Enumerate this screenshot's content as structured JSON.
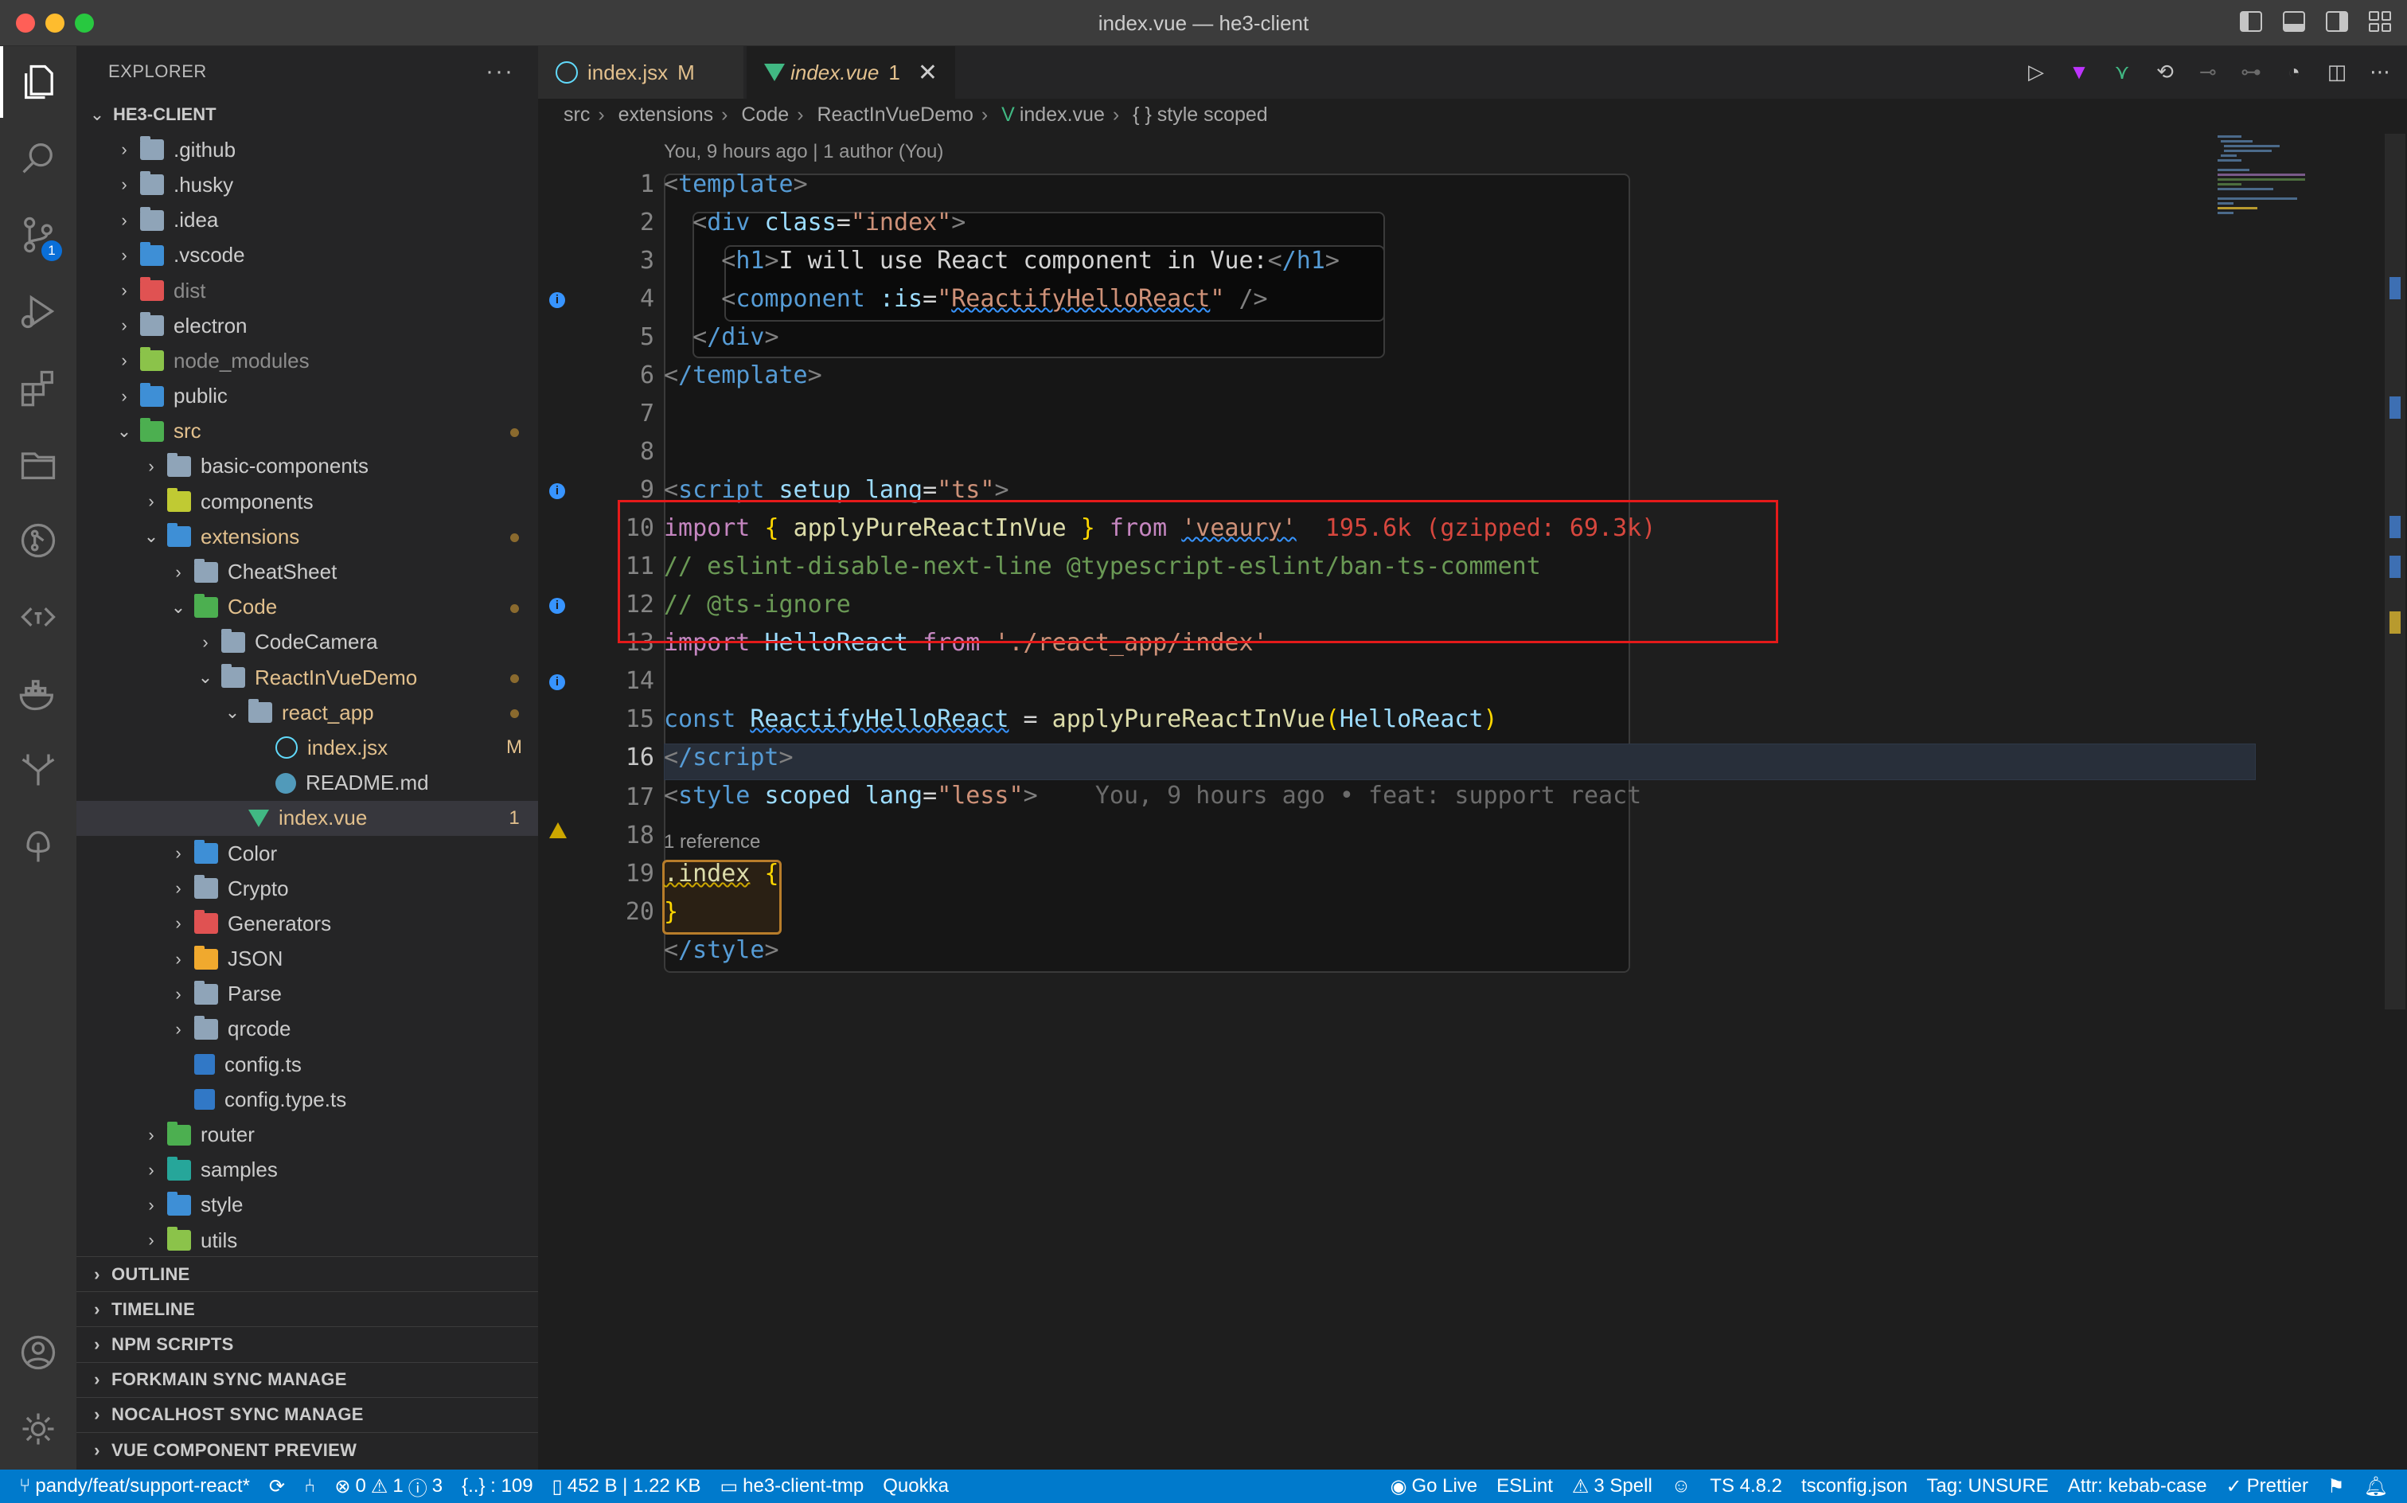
{
  "window": {
    "title": "index.vue — he3-client"
  },
  "activity": {
    "items": [
      "explorer-icon",
      "search-icon",
      "source-control-icon",
      "run-debug-icon",
      "extensions-icon",
      "folders-icon",
      "git-graph-icon",
      "tag-icon",
      "docker-icon",
      "antler-icon",
      "tree-icon"
    ],
    "source_control_badge": "1",
    "bottom": [
      "account-icon",
      "settings-gear-icon"
    ]
  },
  "explorer": {
    "header": "EXPLORER",
    "more": "···",
    "root": "HE3-CLIENT",
    "tree": [
      {
        "label": ".github",
        "indent": 1,
        "type": "folder",
        "chevron": "›",
        "color": "normal",
        "icon_color": "#8fa4b8",
        "status": ""
      },
      {
        "label": ".husky",
        "indent": 1,
        "type": "folder",
        "chevron": "›",
        "color": "normal",
        "icon_color": "#8fa4b8",
        "status": ""
      },
      {
        "label": ".idea",
        "indent": 1,
        "type": "folder",
        "chevron": "›",
        "color": "normal",
        "icon_color": "#8fa4b8",
        "status": ""
      },
      {
        "label": ".vscode",
        "indent": 1,
        "type": "folder",
        "chevron": "›",
        "color": "normal",
        "icon_color": "#3e8fd6",
        "status": ""
      },
      {
        "label": "dist",
        "indent": 1,
        "type": "folder",
        "chevron": "›",
        "color": "ignored",
        "icon_color": "#e05252",
        "status": ""
      },
      {
        "label": "electron",
        "indent": 1,
        "type": "folder",
        "chevron": "›",
        "color": "normal",
        "icon_color": "#8fa4b8",
        "status": ""
      },
      {
        "label": "node_modules",
        "indent": 1,
        "type": "folder",
        "chevron": "›",
        "color": "ignored",
        "icon_color": "#8bc34a",
        "status": ""
      },
      {
        "label": "public",
        "indent": 1,
        "type": "folder",
        "chevron": "›",
        "color": "normal",
        "icon_color": "#3e8fd6",
        "status": ""
      },
      {
        "label": "src",
        "indent": 1,
        "type": "folder",
        "chevron": "⌄",
        "color": "mod",
        "icon_color": "#4caf50",
        "status": "dot"
      },
      {
        "label": "basic-components",
        "indent": 2,
        "type": "folder",
        "chevron": "›",
        "color": "normal",
        "icon_color": "#8fa4b8",
        "status": ""
      },
      {
        "label": "components",
        "indent": 2,
        "type": "folder",
        "chevron": "›",
        "color": "normal",
        "icon_color": "#c0ca33",
        "status": ""
      },
      {
        "label": "extensions",
        "indent": 2,
        "type": "folder",
        "chevron": "⌄",
        "color": "mod",
        "icon_color": "#3e8fd6",
        "status": "dot"
      },
      {
        "label": "CheatSheet",
        "indent": 3,
        "type": "folder",
        "chevron": "›",
        "color": "normal",
        "icon_color": "#8fa4b8",
        "status": ""
      },
      {
        "label": "Code",
        "indent": 3,
        "type": "folder",
        "chevron": "⌄",
        "color": "mod",
        "icon_color": "#4caf50",
        "status": "dot"
      },
      {
        "label": "CodeCamera",
        "indent": 4,
        "type": "folder",
        "chevron": "›",
        "color": "normal",
        "icon_color": "#8fa4b8",
        "status": ""
      },
      {
        "label": "ReactInVueDemo",
        "indent": 4,
        "type": "folder",
        "chevron": "⌄",
        "color": "mod",
        "icon_color": "#8fa4b8",
        "status": "dot"
      },
      {
        "label": "react_app",
        "indent": 5,
        "type": "folder",
        "chevron": "⌄",
        "color": "mod",
        "icon_color": "#8fa4b8",
        "status": "dot"
      },
      {
        "label": "index.jsx",
        "indent": 6,
        "type": "jsx",
        "chevron": "",
        "color": "mod",
        "icon_color": "#61dafb",
        "status": "M"
      },
      {
        "label": "README.md",
        "indent": 6,
        "type": "md",
        "chevron": "",
        "color": "normal",
        "icon_color": "#519aba",
        "status": ""
      },
      {
        "label": "index.vue",
        "indent": 5,
        "type": "vue",
        "chevron": "",
        "color": "mod",
        "icon_color": "#41b883",
        "status": "1",
        "selected": true
      },
      {
        "label": "Color",
        "indent": 3,
        "type": "folder",
        "chevron": "›",
        "color": "normal",
        "icon_color": "#3e8fd6",
        "status": ""
      },
      {
        "label": "Crypto",
        "indent": 3,
        "type": "folder",
        "chevron": "›",
        "color": "normal",
        "icon_color": "#8fa4b8",
        "status": ""
      },
      {
        "label": "Generators",
        "indent": 3,
        "type": "folder",
        "chevron": "›",
        "color": "normal",
        "icon_color": "#e05252",
        "status": ""
      },
      {
        "label": "JSON",
        "indent": 3,
        "type": "folder",
        "chevron": "›",
        "color": "normal",
        "icon_color": "#f0a92e",
        "status": ""
      },
      {
        "label": "Parse",
        "indent": 3,
        "type": "folder",
        "chevron": "›",
        "color": "normal",
        "icon_color": "#8fa4b8",
        "status": ""
      },
      {
        "label": "qrcode",
        "indent": 3,
        "type": "folder",
        "chevron": "›",
        "color": "normal",
        "icon_color": "#8fa4b8",
        "status": ""
      },
      {
        "label": "config.ts",
        "indent": 3,
        "type": "ts",
        "chevron": "",
        "color": "normal",
        "icon_color": "#3178c6",
        "status": ""
      },
      {
        "label": "config.type.ts",
        "indent": 3,
        "type": "ts",
        "chevron": "",
        "color": "normal",
        "icon_color": "#3178c6",
        "status": ""
      },
      {
        "label": "router",
        "indent": 2,
        "type": "folder",
        "chevron": "›",
        "color": "normal",
        "icon_color": "#4caf50",
        "status": ""
      },
      {
        "label": "samples",
        "indent": 2,
        "type": "folder",
        "chevron": "›",
        "color": "normal",
        "icon_color": "#26a69a",
        "status": ""
      },
      {
        "label": "style",
        "indent": 2,
        "type": "folder",
        "chevron": "›",
        "color": "normal",
        "icon_color": "#3e8fd6",
        "status": ""
      },
      {
        "label": "utils",
        "indent": 2,
        "type": "folder",
        "chevron": "›",
        "color": "normal",
        "icon_color": "#8bc34a",
        "status": ""
      }
    ],
    "sections": [
      "OUTLINE",
      "TIMELINE",
      "NPM SCRIPTS",
      "FORKMAIN SYNC MANAGE",
      "NOCALHOST SYNC MANAGE",
      "VUE COMPONENT PREVIEW"
    ]
  },
  "tabs": [
    {
      "label": "index.jsx",
      "tag": "M"
    },
    {
      "label": "index.vue",
      "tag": "1",
      "close": "✕"
    }
  ],
  "tab_actions": [
    "run-icon",
    "vite-icon",
    "vue-devtools-icon",
    "compare-icon",
    "go-back-icon",
    "go-forward-icon",
    "timeline-icon",
    "split-editor-icon",
    "more-actions-icon"
  ],
  "breadcrumb": [
    "src",
    "extensions",
    "Code",
    "ReactInVueDemo",
    "index.vue",
    "{ } style scoped"
  ],
  "codelens_top": "You, 9 hours ago | 1 author (You)",
  "ref_lens": "1 reference",
  "line_numbers": [
    "1",
    "2",
    "3",
    "4",
    "5",
    "6",
    "7",
    "8",
    "9",
    "10",
    "11",
    "12",
    "13",
    "14",
    "15",
    "16",
    "17",
    "18",
    "19",
    "20"
  ],
  "code": {
    "l1_template_open": "template",
    "l2_div": "div",
    "l2_class": "class",
    "l2_value": "\"index\"",
    "l3_h1": "h1",
    "l3_text": "I will use React component in Vue:",
    "l3_h1_close": "/h1",
    "l4_component": "component",
    "l4_is": ":is",
    "l4_value": "ReactifyHelloReact",
    "l5_div_close": "/div",
    "l6_template_close": "/template",
    "l8_script": "script",
    "l8_setup": "setup",
    "l8_lang": "lang",
    "l8_value": "\"ts\"",
    "l9_import": "import",
    "l9_fn": "applyPureReactInVue",
    "l9_from": "from",
    "l9_src": "'veaury'",
    "l9_size": "195.6k (gzipped: 69.3k)",
    "l10_comment": "// eslint-disable-next-line @typescript-eslint/ban-ts-comment",
    "l11_comment": "// @ts-ignore",
    "l12_import": "import",
    "l12_name": "HelloReact",
    "l12_from": "from",
    "l12_src": "'./react_app/index'",
    "l14_const": "const",
    "l14_name": "ReactifyHelloReact",
    "l14_fn": "applyPureReactInVue",
    "l14_arg": "HelloReact",
    "l15_script_close": "/script",
    "l16_style": "style",
    "l16_scoped": "scoped",
    "l16_lang": "lang",
    "l16_value": "\"less\"",
    "l16_blame": "You, 9 hours ago • feat: support react",
    "l17_selector": ".index",
    "l17_brace": "{",
    "l18_brace": "}",
    "l19_style_close": "/style"
  },
  "status": {
    "branch": "pandy/feat/support-react*",
    "problems": {
      "errors": "0",
      "warnings": "1",
      "infos": "3"
    },
    "selection": "{..} : 109",
    "sizes": "452 B | 1.22 KB",
    "workspace": "he3-client-tmp",
    "quokka": "Quokka",
    "go_live": "Go Live",
    "eslint": "ESLint",
    "spell": "3 Spell",
    "ts_version": "TS 4.8.2",
    "tsconfig": "tsconfig.json",
    "tag": "Tag: UNSURE",
    "attr": "Attr: kebab-case",
    "prettier": "Prettier"
  },
  "colors": {
    "accent": "#007acc",
    "modified": "#e2c08d",
    "highlight": "#e51a1a",
    "info": "#3794ff",
    "warning": "#cca700"
  }
}
